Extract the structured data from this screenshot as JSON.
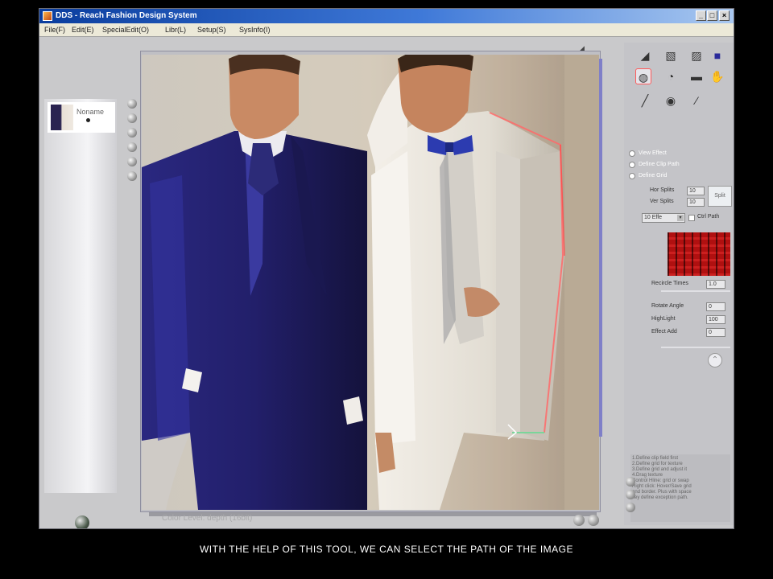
{
  "window": {
    "title": "DDS - Reach Fashion Design System",
    "min_glyph": "_",
    "max_glyph": "□",
    "close_glyph": "×"
  },
  "menubar": {
    "items": [
      "File(F)",
      "Edit(E)",
      "SpecialEdit(O)",
      "Libr(L)",
      "Setup(S)",
      "SysInfo(I)"
    ]
  },
  "thumbnail": {
    "label": "Noname"
  },
  "right_panel": {
    "options": [
      "View Effect",
      "Define Clip Path",
      "Define Grid"
    ],
    "hor_splits_label": "Hor Splits",
    "hor_splits_value": "10",
    "ver_splits_label": "Ver Splits",
    "ver_splits_value": "10",
    "split_button": "Split",
    "combo_value": "10 Effe",
    "combo_arrow": "▾",
    "ctrl_label": "Ctrl Path",
    "recircle_label": "Recircle Times",
    "recircle_value": "1.0",
    "rotate_label": "Rotate Angle",
    "rotate_value": "0",
    "highlight_label": "HighLight",
    "highlight_value": "100",
    "effect_label": "Effect Add",
    "effect_value": "0",
    "up_glyph": "⌃",
    "instructions": "1.Define clip field first\n2.Define grid for texture\n3.Define grid and adjust it\n4.Drag texture\nControl Hline: grid or swap\nRight click: Hover/Save grid\nand border. Plus with space\nkey define exception path."
  },
  "status": {
    "text": "Color Level: depth (16bit)"
  },
  "caption": "WITH THE HELP OF THIS TOOL, WE CAN SELECT THE PATH OF THE IMAGE",
  "colors": {
    "title_start": "#0a3d9e",
    "title_end": "#a9c8f0",
    "pattern_red": "#b01010",
    "selection_path": "#ff6a6a",
    "panel_gray": "#c4c4c8"
  },
  "icons": [
    "gradient-tool-icon",
    "brush-tool-icon",
    "fill-tool-icon",
    "palette-tool-icon",
    "select-path-tool-icon",
    "rotate-tool-icon",
    "eraser-tool-icon",
    "hand-tool-icon",
    "pen-tool-icon",
    "globe-tool-icon",
    "eyedropper-tool-icon"
  ]
}
